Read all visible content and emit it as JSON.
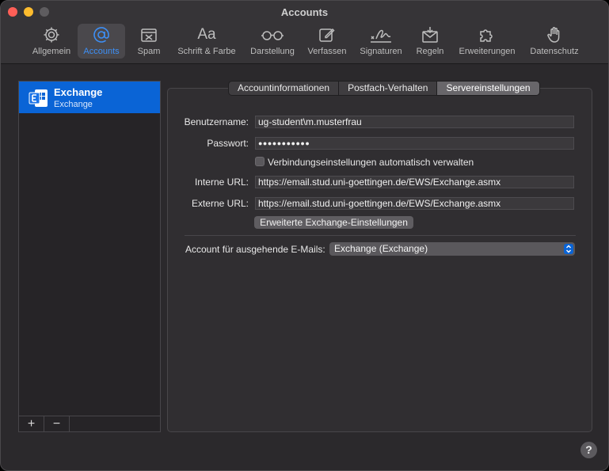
{
  "window": {
    "title": "Accounts"
  },
  "toolbar": {
    "items": [
      {
        "label": "Allgemein",
        "icon": "gear-icon"
      },
      {
        "label": "Accounts",
        "icon": "at-icon"
      },
      {
        "label": "Spam",
        "icon": "junk-tray-icon"
      },
      {
        "label": "Schrift & Farbe",
        "icon": "font-icon",
        "glyph": "Aa"
      },
      {
        "label": "Darstellung",
        "icon": "glasses-icon"
      },
      {
        "label": "Verfassen",
        "icon": "compose-icon"
      },
      {
        "label": "Signaturen",
        "icon": "signature-icon"
      },
      {
        "label": "Regeln",
        "icon": "rules-envelope-icon"
      },
      {
        "label": "Erweiterungen",
        "icon": "puzzle-icon"
      },
      {
        "label": "Datenschutz",
        "icon": "hand-icon"
      }
    ],
    "active_index": 1,
    "accent_color": "#3d8ff5"
  },
  "sidebar": {
    "accounts": [
      {
        "name": "Exchange",
        "type": "Exchange"
      }
    ],
    "add_label": "+",
    "remove_label": "−"
  },
  "tabs": {
    "items": [
      "Accountinformationen",
      "Postfach-Verhalten",
      "Servereinstellungen"
    ],
    "active_index": 2
  },
  "form": {
    "username_label": "Benutzername:",
    "username_value": "ug-student\\m.musterfrau",
    "password_label": "Passwort:",
    "password_value": "●●●●●●●●●●●",
    "auto_manage_label": "Verbindungseinstellungen automatisch verwalten",
    "auto_manage_checked": false,
    "internal_url_label": "Interne URL:",
    "internal_url_value": "https://email.stud.uni-goettingen.de/EWS/Exchange.asmx",
    "external_url_label": "Externe URL:",
    "external_url_value": "https://email.stud.uni-goettingen.de/EWS/Exchange.asmx",
    "advanced_button": "Erweiterte Exchange-Einstellungen",
    "outgoing_label": "Account für ausgehende E-Mails:",
    "outgoing_value": "Exchange (Exchange)"
  },
  "help": {
    "label": "?"
  }
}
